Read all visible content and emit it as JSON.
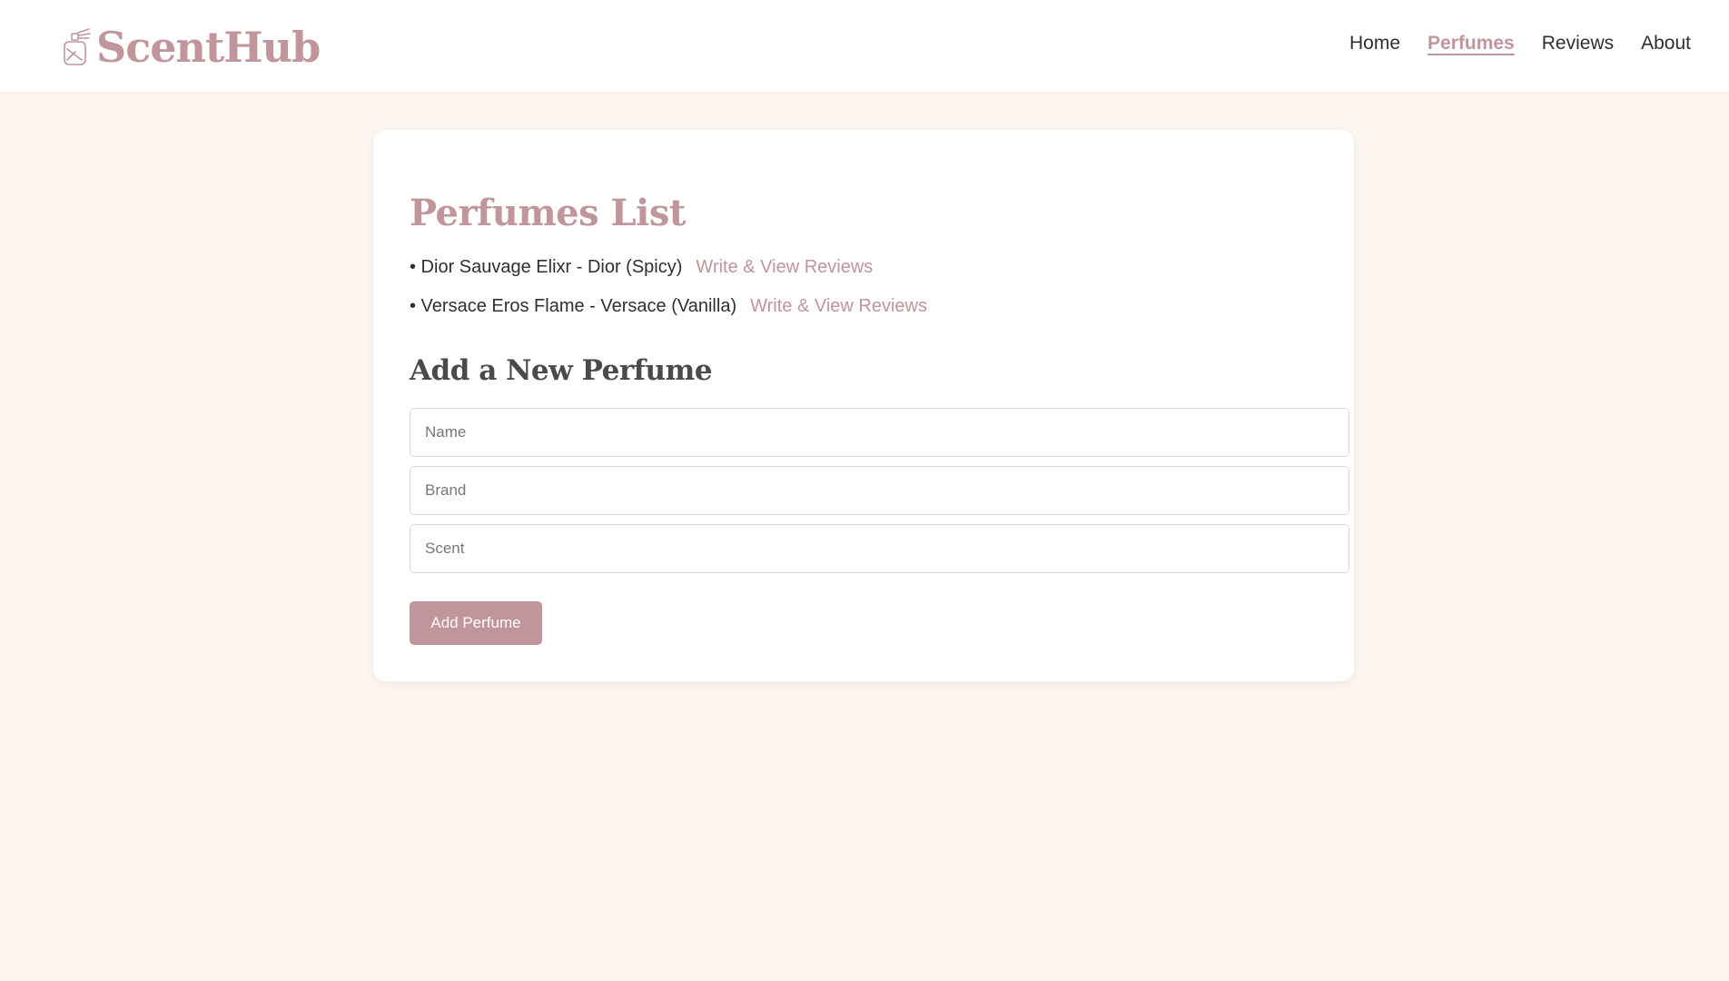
{
  "brand": {
    "name": "ScentHub",
    "icon": "perfume-bottle-icon",
    "color": "#c0959c"
  },
  "nav": [
    {
      "label": "Home",
      "active": false
    },
    {
      "label": "Perfumes",
      "active": true
    },
    {
      "label": "Reviews",
      "active": false
    },
    {
      "label": "About",
      "active": false
    }
  ],
  "perfumes_section": {
    "title": "Perfumes List",
    "items": [
      {
        "text": "• Dior Sauvage Elixr - Dior (Spicy)",
        "link": "Write & View Reviews"
      },
      {
        "text": "• Versace Eros Flame - Versace (Vanilla)",
        "link": "Write & View Reviews"
      }
    ]
  },
  "form": {
    "title": "Add a New Perfume",
    "name_placeholder": "Name",
    "brand_placeholder": "Brand",
    "scent_placeholder": "Scent",
    "submit_label": "Add Perfume"
  },
  "colors": {
    "accent": "#c0959c",
    "background": "#fcf5f0",
    "card": "#ffffff"
  }
}
